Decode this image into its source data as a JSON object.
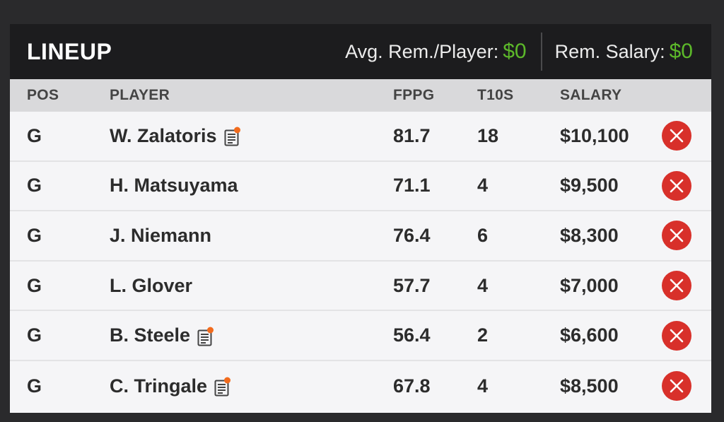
{
  "header": {
    "title": "LINEUP",
    "avg_label": "Avg. Rem./Player:",
    "avg_value": "$0",
    "rem_label": "Rem. Salary:",
    "rem_value": "$0"
  },
  "columns": {
    "pos": "POS",
    "player": "PLAYER",
    "fppg": "FPPG",
    "t10s": "T10S",
    "salary": "SALARY"
  },
  "rows": [
    {
      "pos": "G",
      "player": "W. Zalatoris",
      "has_note": true,
      "fppg": "81.7",
      "t10s": "18",
      "salary": "$10,100"
    },
    {
      "pos": "G",
      "player": "H. Matsuyama",
      "has_note": false,
      "fppg": "71.1",
      "t10s": "4",
      "salary": "$9,500"
    },
    {
      "pos": "G",
      "player": "J. Niemann",
      "has_note": false,
      "fppg": "76.4",
      "t10s": "6",
      "salary": "$8,300"
    },
    {
      "pos": "G",
      "player": "L. Glover",
      "has_note": false,
      "fppg": "57.7",
      "t10s": "4",
      "salary": "$7,000"
    },
    {
      "pos": "G",
      "player": "B. Steele",
      "has_note": true,
      "fppg": "56.4",
      "t10s": "2",
      "salary": "$6,600"
    },
    {
      "pos": "G",
      "player": "C. Tringale",
      "has_note": true,
      "fppg": "67.8",
      "t10s": "4",
      "salary": "$8,500"
    }
  ],
  "colors": {
    "accent_green": "#5cb82a",
    "remove_red": "#d8302a",
    "note_dot": "#f26b1d"
  },
  "icons": {
    "note": "player-news-icon",
    "remove": "remove-player-icon"
  }
}
